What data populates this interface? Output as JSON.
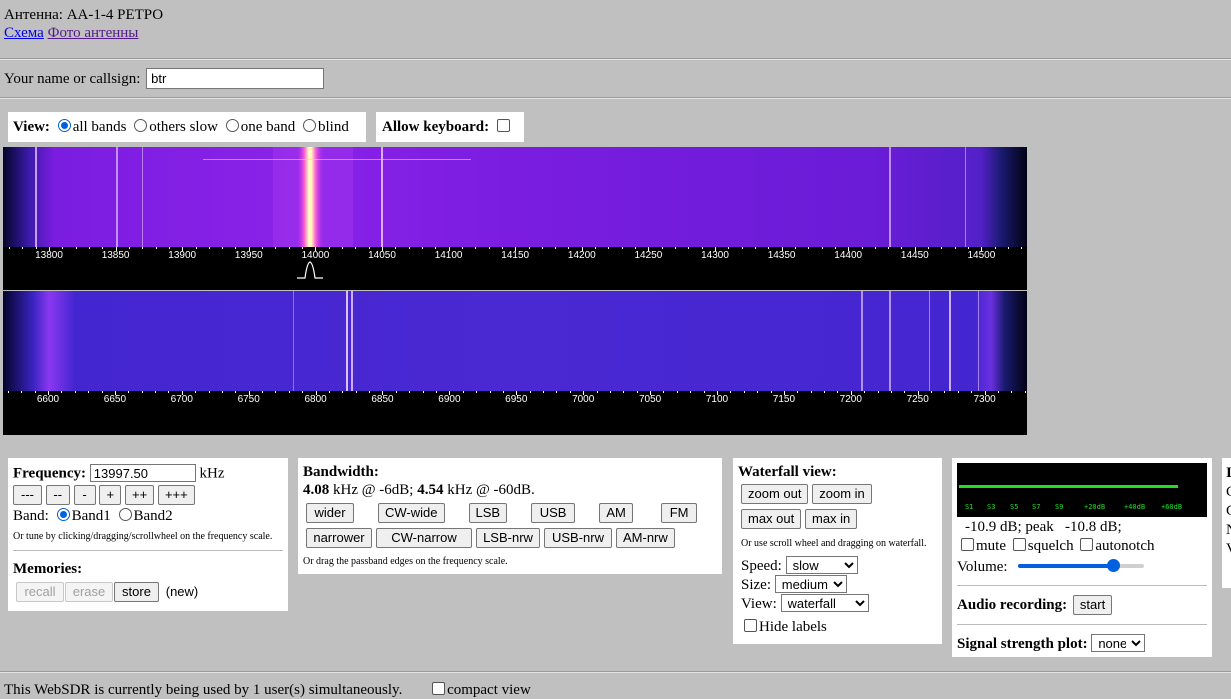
{
  "header": {
    "title": "Антенна: АА-1-4 РЕТРО",
    "link_scheme": "Схема",
    "link_photo": "Фото антенны"
  },
  "callsign": {
    "label": "Your name or callsign:",
    "value": "btr"
  },
  "view": {
    "label": "View:",
    "options": [
      "all bands",
      "others slow",
      "one band",
      "blind"
    ],
    "selected": "all bands",
    "keyboard_label": "Allow keyboard:"
  },
  "waterfall1": {
    "ticks": [
      "13800",
      "13850",
      "13900",
      "13950",
      "14000",
      "14050",
      "14100",
      "14150",
      "14200",
      "14250",
      "14300",
      "14350",
      "14400",
      "14450",
      "14500"
    ]
  },
  "waterfall2": {
    "ticks": [
      "6600",
      "6650",
      "6700",
      "6750",
      "6800",
      "6850",
      "6900",
      "6950",
      "7000",
      "7050",
      "7100",
      "7150",
      "7200",
      "7250",
      "7300"
    ]
  },
  "frequency": {
    "label": "Frequency:",
    "value": "13997.50",
    "unit": "kHz",
    "buttons": [
      "---",
      "--",
      "-",
      "+",
      "++",
      "+++"
    ],
    "band_label": "Band:",
    "band1": "Band1",
    "band2": "Band2",
    "hint": "Or tune by clicking/dragging/scrollwheel on the frequency scale."
  },
  "memories": {
    "label": "Memories:",
    "recall": "recall",
    "erase": "erase",
    "store": "store",
    "status": "(new)"
  },
  "bandwidth": {
    "label": "Bandwidth:",
    "bw6": "4.08",
    "text6": " kHz @ -6dB; ",
    "bw60": "4.54",
    "text60": " kHz @ -60dB.",
    "row1": [
      "wider",
      "CW-wide",
      "LSB",
      "USB",
      "AM",
      "FM"
    ],
    "row2": [
      "narrower",
      "CW-narrow",
      "LSB-nrw",
      "USB-nrw",
      "AM-nrw"
    ],
    "hint": "Or drag the passband edges on the frequency scale."
  },
  "waterfall_view": {
    "label": "Waterfall view:",
    "zoom_out": "zoom out",
    "zoom_in": "zoom in",
    "max_out": "max out",
    "max_in": "max in",
    "hint": "Or use scroll wheel and dragging on waterfall.",
    "speed_label": "Speed:",
    "speed": "slow",
    "size_label": "Size:",
    "size": "medium",
    "view_label": "View:",
    "view": "waterfall",
    "hide_labels": "Hide labels"
  },
  "audio": {
    "smeter_labels": [
      "S1",
      "S3",
      "S5",
      "S7",
      "S9",
      "+20dB",
      "+40dB",
      "+60dB"
    ],
    "level_text": "-10.9 dB; peak   -10.8 dB;",
    "smeter_fraction": 0.89,
    "mute": "mute",
    "squelch": "squelch",
    "autonotch": "autonotch",
    "volume_label": "Volume:",
    "volume_fraction": 0.75,
    "recording_label": "Audio recording:",
    "start": "start",
    "plot_label": "Signal strength plot:",
    "plot_value": "none"
  },
  "right_edge": {
    "chars": [
      "I",
      "C",
      "C",
      "N",
      "V"
    ]
  },
  "footer": {
    "users_text": "This WebSDR is currently being used by 1 user(s) simultaneously.",
    "compact_view": "compact view"
  },
  "colors": {
    "waterfall_bg": "#000000",
    "spectrum_purple": "#7a1de0",
    "spectrum_blue": "#4426d0",
    "smeter_green": "#22dd22",
    "accent_blue": "#0060df"
  }
}
